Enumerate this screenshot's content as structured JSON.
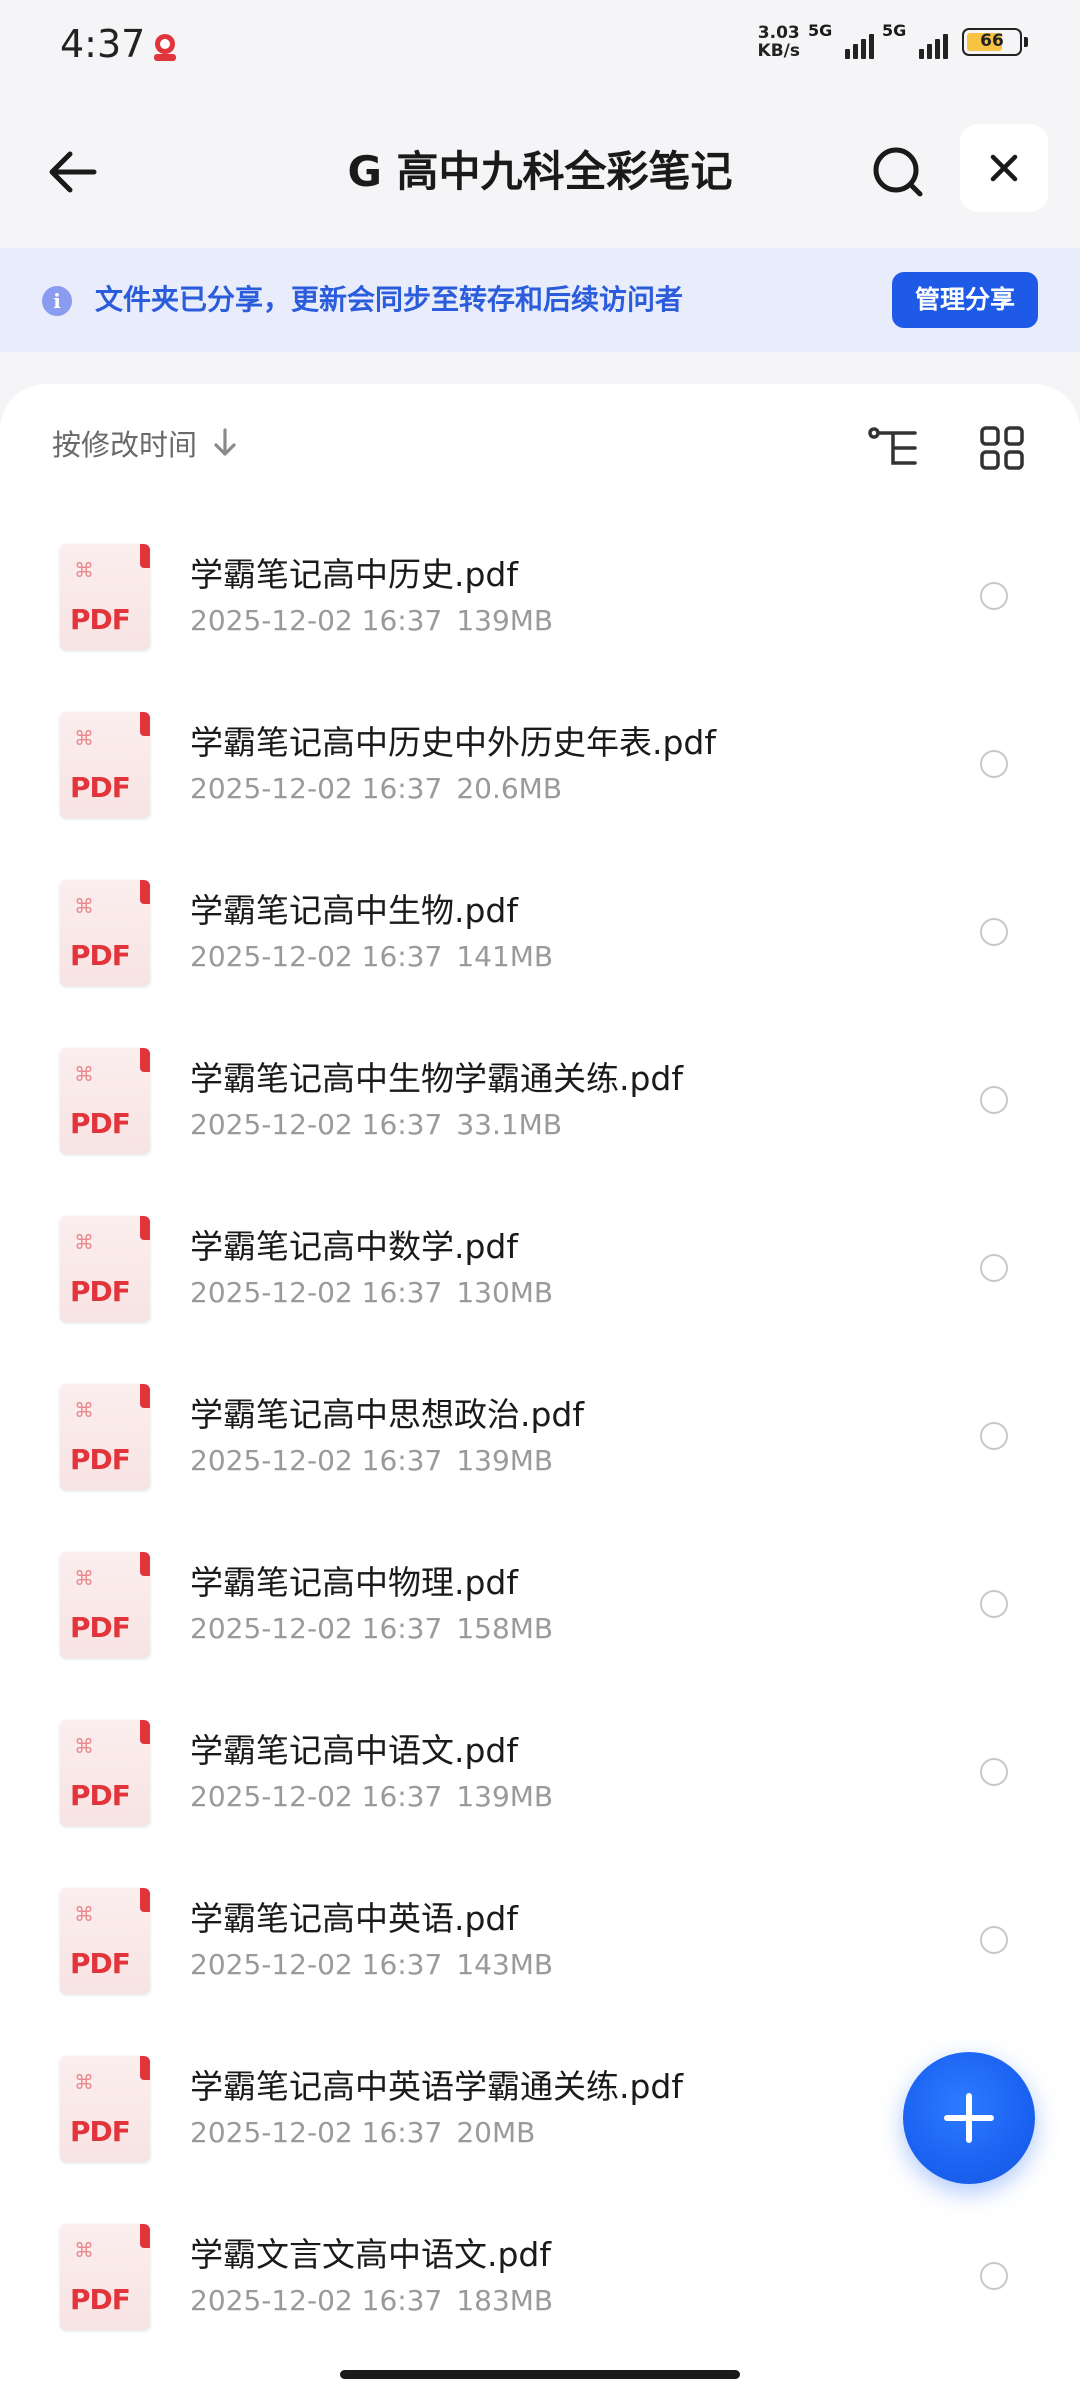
{
  "status_bar": {
    "time": "4:37",
    "net_speed_value": "3.03",
    "net_speed_unit": "KB/s",
    "signal1_label": "5G",
    "signal2_label": "5G",
    "battery_level": "66"
  },
  "header": {
    "title": "G 高中九科全彩笔记",
    "back_icon": "arrow-left-icon",
    "search_icon": "search-icon",
    "close_icon": "close-icon"
  },
  "banner": {
    "text": "文件夹已分享，更新会同步至转存和后续访问者",
    "manage_label": "管理分享",
    "accent_color": "#1e5ae6"
  },
  "toolbar": {
    "sort_label": "按修改时间"
  },
  "files": [
    {
      "name": "学霸笔记高中历史.pdf",
      "date": "2025-12-02 16:37",
      "size": "139MB"
    },
    {
      "name": "学霸笔记高中历史中外历史年表.pdf",
      "date": "2025-12-02 16:37",
      "size": "20.6MB"
    },
    {
      "name": "学霸笔记高中生物.pdf",
      "date": "2025-12-02 16:37",
      "size": "141MB"
    },
    {
      "name": "学霸笔记高中生物学霸通关练.pdf",
      "date": "2025-12-02 16:37",
      "size": "33.1MB"
    },
    {
      "name": "学霸笔记高中数学.pdf",
      "date": "2025-12-02 16:37",
      "size": "130MB"
    },
    {
      "name": "学霸笔记高中思想政治.pdf",
      "date": "2025-12-02 16:37",
      "size": "139MB"
    },
    {
      "name": "学霸笔记高中物理.pdf",
      "date": "2025-12-02 16:37",
      "size": "158MB"
    },
    {
      "name": "学霸笔记高中语文.pdf",
      "date": "2025-12-02 16:37",
      "size": "139MB"
    },
    {
      "name": "学霸笔记高中英语.pdf",
      "date": "2025-12-02 16:37",
      "size": "143MB"
    },
    {
      "name": "学霸笔记高中英语学霸通关练.pdf",
      "date": "2025-12-02 16:37",
      "size": "20MB"
    },
    {
      "name": "学霸文言文高中语文.pdf",
      "date": "2025-12-02 16:37",
      "size": "183MB"
    }
  ],
  "file_icon_label": "PDF"
}
